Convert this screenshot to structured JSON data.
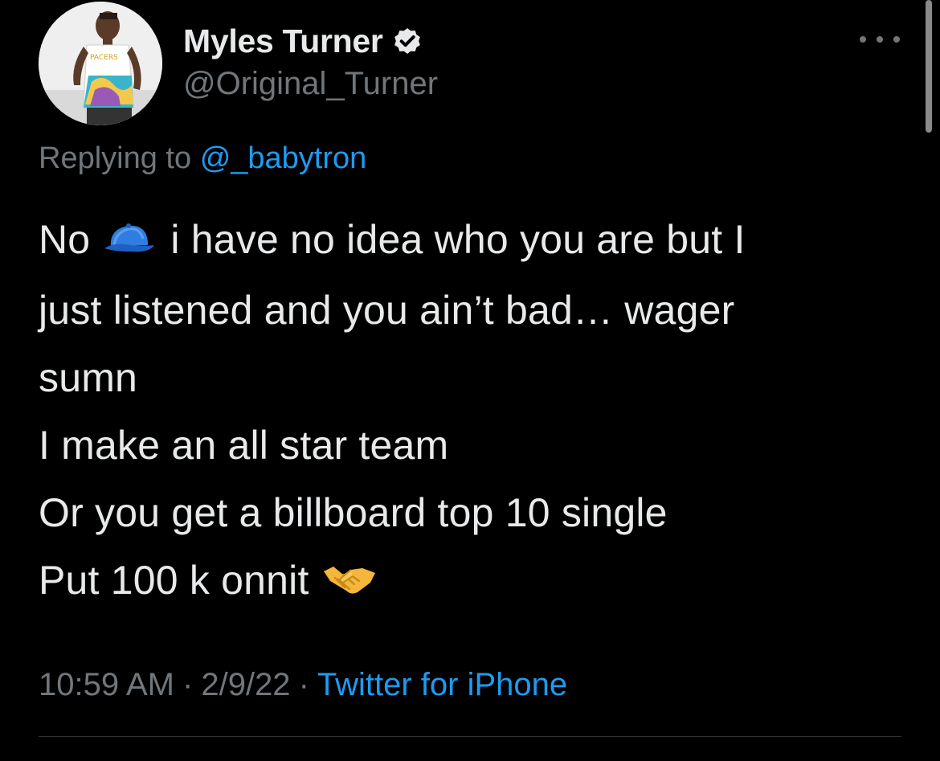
{
  "author": {
    "display_name": "Myles Turner",
    "handle": "@Original_Turner",
    "verified": true
  },
  "reply": {
    "prefix": "Replying to",
    "mention": "@_babytron"
  },
  "body": {
    "line1_a": "No",
    "line1_b": "i have no idea who you are but I",
    "line2": "just listened and you ain’t bad… wager",
    "line3": "sumn",
    "line4": "I make an all star team",
    "line5": "Or you get a billboard top 10 single",
    "line6": "Put 100 k onnit",
    "emoji_1": "blue-cap-emoji",
    "emoji_2": "handshake-emoji"
  },
  "meta": {
    "time": "10:59 AM",
    "date": "2/9/22",
    "separator": "·",
    "source": "Twitter for iPhone"
  },
  "colors": {
    "background": "#000000",
    "text": "#e7e9ea",
    "secondary": "#71767b",
    "accent": "#1d9bf0"
  }
}
